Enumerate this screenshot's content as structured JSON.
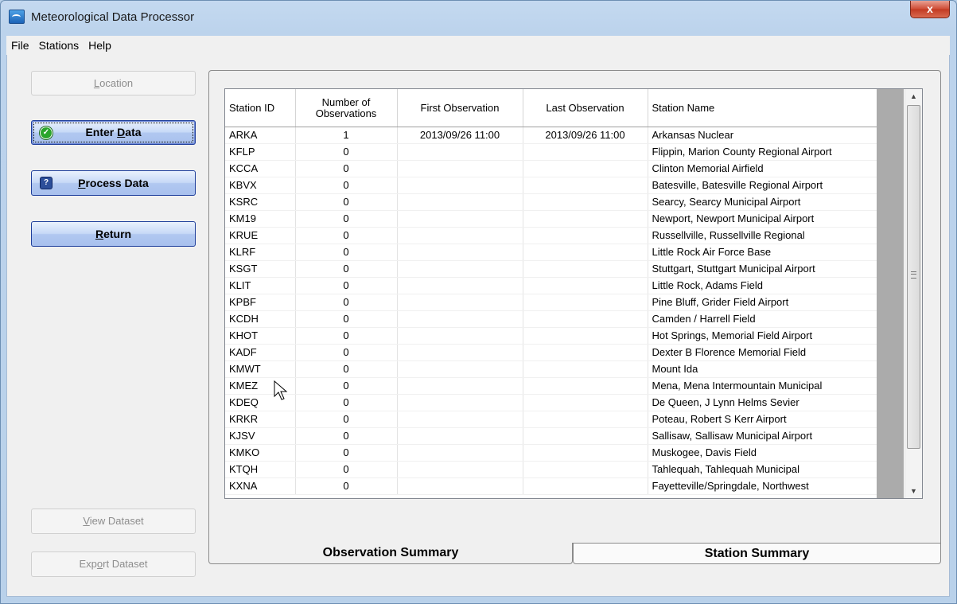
{
  "window": {
    "title": "Meteorological Data Processor",
    "close_glyph": "x"
  },
  "menu": [
    "File",
    "Stations",
    "Help"
  ],
  "buttons": {
    "location": {
      "pre": "",
      "key": "L",
      "post": "ocation"
    },
    "enter_data": {
      "pre": "Enter ",
      "key": "D",
      "post": "ata"
    },
    "process_data": {
      "pre": "",
      "key": "P",
      "post": "rocess Data"
    },
    "return": {
      "pre": "",
      "key": "R",
      "post": "eturn"
    },
    "view_dataset": {
      "pre": "",
      "key": "V",
      "post": "iew Dataset"
    },
    "export_dataset": {
      "pre": "Exp",
      "key": "o",
      "post": "rt Dataset"
    }
  },
  "table": {
    "headers": [
      "Station ID",
      "Number of Observations",
      "First Observation",
      "Last Observation",
      "Station Name"
    ],
    "rows": [
      [
        "ARKA",
        "1",
        "2013/09/26 11:00",
        "2013/09/26 11:00",
        "Arkansas Nuclear"
      ],
      [
        "KFLP",
        "0",
        "",
        "",
        "Flippin, Marion County Regional Airport"
      ],
      [
        "KCCA",
        "0",
        "",
        "",
        "Clinton Memorial Airfield"
      ],
      [
        "KBVX",
        "0",
        "",
        "",
        "Batesville, Batesville Regional Airport"
      ],
      [
        "KSRC",
        "0",
        "",
        "",
        "Searcy, Searcy Municipal Airport"
      ],
      [
        "KM19",
        "0",
        "",
        "",
        "Newport, Newport Municipal Airport"
      ],
      [
        "KRUE",
        "0",
        "",
        "",
        "Russellville, Russellville Regional"
      ],
      [
        "KLRF",
        "0",
        "",
        "",
        "Little Rock Air Force Base"
      ],
      [
        "KSGT",
        "0",
        "",
        "",
        "Stuttgart, Stuttgart Municipal Airport"
      ],
      [
        "KLIT",
        "0",
        "",
        "",
        "Little Rock, Adams Field"
      ],
      [
        "KPBF",
        "0",
        "",
        "",
        "Pine Bluff, Grider Field Airport"
      ],
      [
        "KCDH",
        "0",
        "",
        "",
        "Camden / Harrell Field"
      ],
      [
        "KHOT",
        "0",
        "",
        "",
        "Hot Springs, Memorial Field Airport"
      ],
      [
        "KADF",
        "0",
        "",
        "",
        "Dexter B Florence Memorial Field"
      ],
      [
        "KMWT",
        "0",
        "",
        "",
        "Mount Ida"
      ],
      [
        "KMEZ",
        "0",
        "",
        "",
        "Mena, Mena Intermountain Municipal"
      ],
      [
        "KDEQ",
        "0",
        "",
        "",
        "De Queen, J Lynn Helms Sevier"
      ],
      [
        "KRKR",
        "0",
        "",
        "",
        "Poteau, Robert S Kerr Airport"
      ],
      [
        "KJSV",
        "0",
        "",
        "",
        "Sallisaw, Sallisaw Municipal Airport"
      ],
      [
        "KMKO",
        "0",
        "",
        "",
        "Muskogee, Davis Field"
      ],
      [
        "KTQH",
        "0",
        "",
        "",
        "Tahlequah, Tahlequah Municipal"
      ],
      [
        "KXNA",
        "0",
        "",
        "",
        "Fayetteville/Springdale, Northwest"
      ]
    ]
  },
  "tabs": [
    "Observation Summary",
    "Station Summary"
  ],
  "icons": {
    "enter_data": "check-icon",
    "process_data": "help-icon",
    "app": "app-icon",
    "scroll_grip": "grip-icon"
  },
  "colors": {
    "accent_border": "#1f3f9b",
    "check_green": "#2aa52a",
    "help_blue": "#2d4f9a",
    "close_red": "#c23a22"
  }
}
